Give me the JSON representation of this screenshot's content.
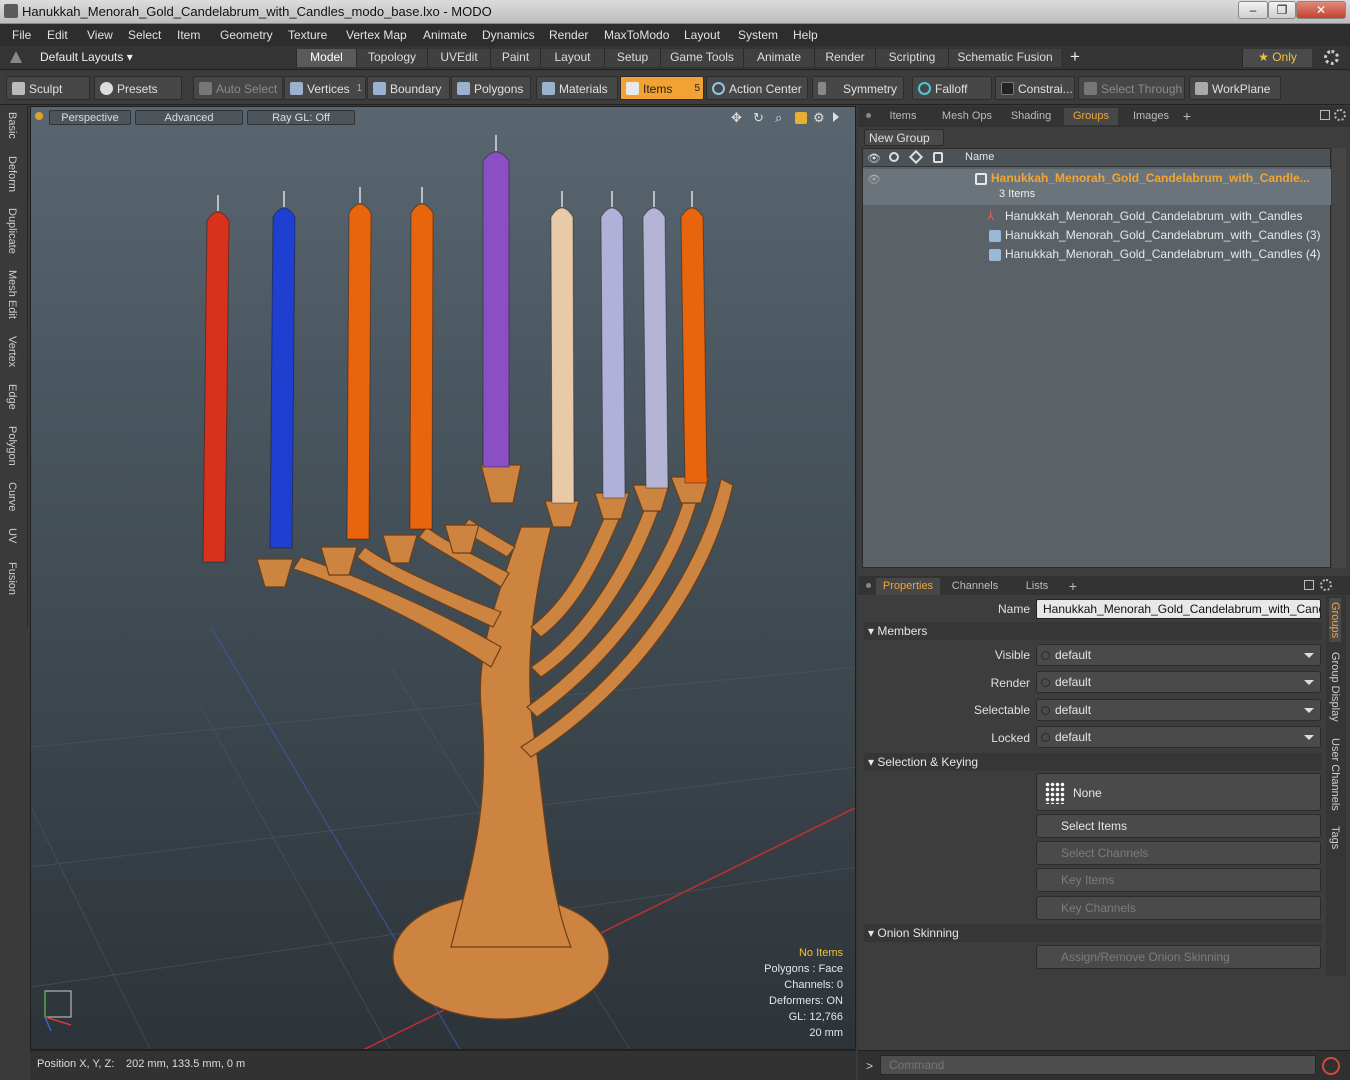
{
  "window": {
    "title": "Hanukkah_Menorah_Gold_Candelabrum_with_Candles_modo_base.lxo - MODO",
    "minimize": "–",
    "maximize": "❐",
    "close": "✕"
  },
  "menu": [
    "File",
    "Edit",
    "View",
    "Select",
    "Item",
    "Geometry",
    "Texture",
    "Vertex Map",
    "Animate",
    "Dynamics",
    "Render",
    "MaxToModo",
    "Layout",
    "System",
    "Help"
  ],
  "layout": {
    "dropdown": "Default Layouts ▾",
    "tabs": [
      "Model",
      "Topology",
      "UVEdit",
      "Paint",
      "Layout",
      "Setup",
      "Game Tools",
      "Animate",
      "Render",
      "Scripting",
      "Schematic Fusion"
    ],
    "active_tab": "Model",
    "plus": "+",
    "only": "★  Only"
  },
  "toolbar": {
    "sculpt": "Sculpt",
    "presets": "Presets",
    "auto_select": "Auto Select",
    "vertices": "Vertices",
    "vertices_count": "1",
    "boundary": "Boundary",
    "polygons": "Polygons",
    "materials": "Materials",
    "items": "Items",
    "items_count": "5",
    "action_center": "Action Center",
    "symmetry": "Symmetry",
    "falloff": "Falloff",
    "constraints": "Constrai...",
    "select_through": "Select Through",
    "workplane": "WorkPlane"
  },
  "left_tabs": [
    "Basic",
    "Deform",
    "Duplicate",
    "Mesh Edit",
    "Vertex",
    "Edge",
    "Polygon",
    "Curve",
    "UV",
    "Fusion"
  ],
  "viewport": {
    "perspective": "Perspective",
    "advanced": "Advanced",
    "raygl": "Ray GL: Off",
    "stats": {
      "no_items": "No Items",
      "polygons": "Polygons : Face",
      "channels": "Channels: 0",
      "deformers": "Deformers: ON",
      "gl": "GL: 12,766",
      "scale": "20 mm"
    },
    "candle_colors": [
      "#d8321c",
      "#1f3fd0",
      "#e8650e",
      "#e8650e",
      "#8a4fc2",
      "#e8c9a8",
      "#b0b0d8",
      "#b4b4d4",
      "#e8650e"
    ]
  },
  "status": {
    "position_label": "Position X, Y, Z:",
    "position_value": "202 mm, 133.5 mm, 0 m"
  },
  "panel_top": {
    "tabs": [
      "Items",
      "Mesh Ops",
      "Shading",
      "Groups",
      "Images"
    ],
    "active": "Groups",
    "plus": "+",
    "new_group": "New Group",
    "col_name": "Name",
    "group_name": "Hanukkah_Menorah_Gold_Candelabrum_with_Candle...",
    "group_count": "3 Items",
    "children": [
      "Hanukkah_Menorah_Gold_Candelabrum_with_Candles",
      "Hanukkah_Menorah_Gold_Candelabrum_with_Candles (3)",
      "Hanukkah_Menorah_Gold_Candelabrum_with_Candles (4)"
    ]
  },
  "panel_bottom": {
    "tabs": [
      "Properties",
      "Channels",
      "Lists"
    ],
    "active": "Properties",
    "plus": "+",
    "name_label": "Name",
    "name_value": "Hanukkah_Menorah_Gold_Candelabrum_with_Candles",
    "members": "Members",
    "rows": [
      {
        "label": "Visible",
        "value": "default"
      },
      {
        "label": "Render",
        "value": "default"
      },
      {
        "label": "Selectable",
        "value": "default"
      },
      {
        "label": "Locked",
        "value": "default"
      }
    ],
    "selection_keying": "Selection & Keying",
    "none": "None",
    "select_items": "Select Items",
    "select_channels": "Select Channels",
    "key_items": "Key Items",
    "key_channels": "Key Channels",
    "onion": "Onion Skinning",
    "assign_onion": "Assign/Remove Onion Skinning",
    "side_tabs": [
      "Groups",
      "Group Display",
      "User Channels",
      "Tags"
    ]
  },
  "command": {
    "placeholder": "Command",
    "prompt": ">"
  },
  "colors": {
    "accent": "#f2a533"
  }
}
